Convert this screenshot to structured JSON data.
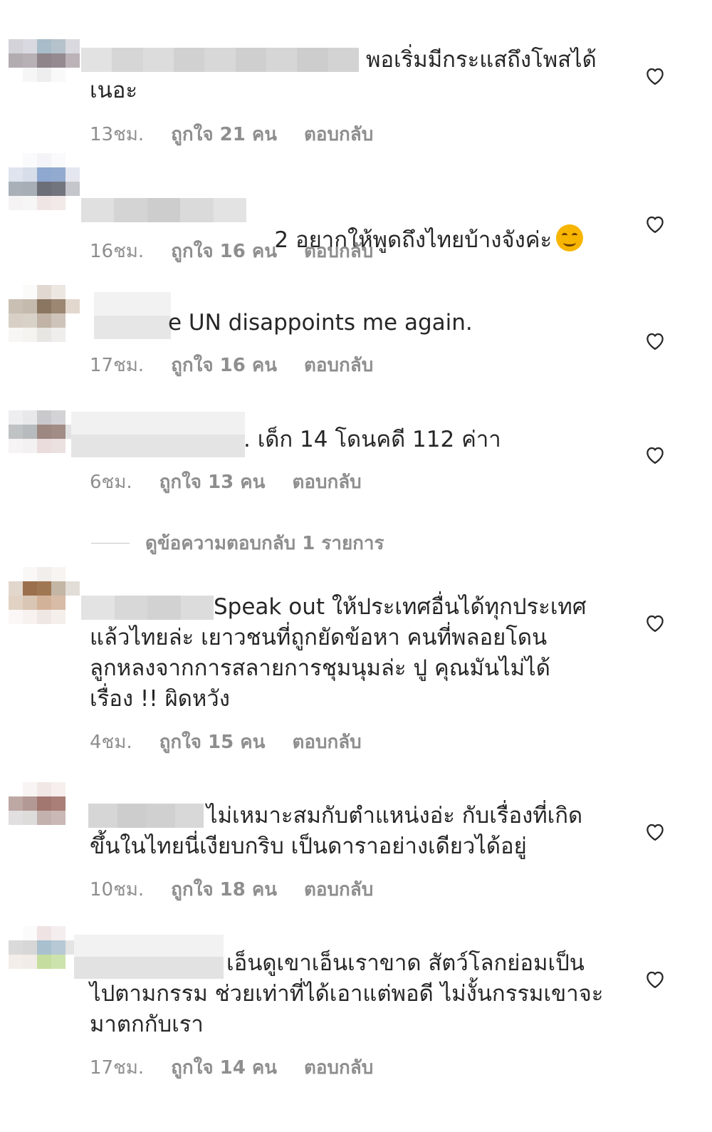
{
  "comments": [
    {
      "text": "พอเริ่มมีกระแสถึงโพสได้\nเนอะ",
      "time": "13ชม.",
      "likes": "ถูกใจ 21 คน",
      "reply": "ตอบกลับ"
    },
    {
      "text": "2 อยากให้พูดถึงไทยบ้างจังค่ะ",
      "emoji": "smiling-face-emoji",
      "time": "16ชม.",
      "likes": "ถูกใจ 16 คน",
      "reply": "ตอบกลับ"
    },
    {
      "text": "e UN disappoints me again.",
      "time": "17ชม.",
      "likes": "ถูกใจ 16 คน",
      "reply": "ตอบกลับ"
    },
    {
      "text": ". เด็ก 14 โดนคดี 112 ค่าา",
      "time": "6ชม.",
      "likes": "ถูกใจ 13 คน",
      "reply": "ตอบกลับ",
      "view_replies": "ดูข้อความตอบกลับ 1 รายการ"
    },
    {
      "text": "Speak out ให้ประเทศอื่นได้ทุกประเทศ\nแล้วไทยล่ะ เยาวชนที่ถูกยัดข้อหา คนที่พลอยโดน\nลูกหลงจากการสลายการชุมนุมล่ะ ปู คุณมันไม่ได้\nเรื่อง !! ผิดหวัง",
      "time": "4ชม.",
      "likes": "ถูกใจ 15 คน",
      "reply": "ตอบกลับ"
    },
    {
      "text": "ไม่เหมาะสมกับตำแหน่งอ่ะ กับเรื่องที่เกิด\nขึ้นในไทยนี่เงียบกริบ เป็นดาราอย่างเดียวได้อยู่",
      "time": "10ชม.",
      "likes": "ถูกใจ 18 คน",
      "reply": "ตอบกลับ"
    },
    {
      "text": "เอ็นดูเขาเอ็นเราขาด สัตว์โลกย่อมเป็น\nไปตามกรรม ช่วยเท่าที่ได้เอาแต่พอดี ไม่งั้นกรรมเขาจะ\nมาตกกับเรา",
      "time": "17ชม.",
      "likes": "ถูกใจ 14 คน",
      "reply": "ตอบกลับ"
    }
  ],
  "icons": {
    "like": "heart-outline-icon"
  },
  "colors": {
    "text": "#262626",
    "meta": "#8e8e8e",
    "divider": "#c7c7c7"
  }
}
